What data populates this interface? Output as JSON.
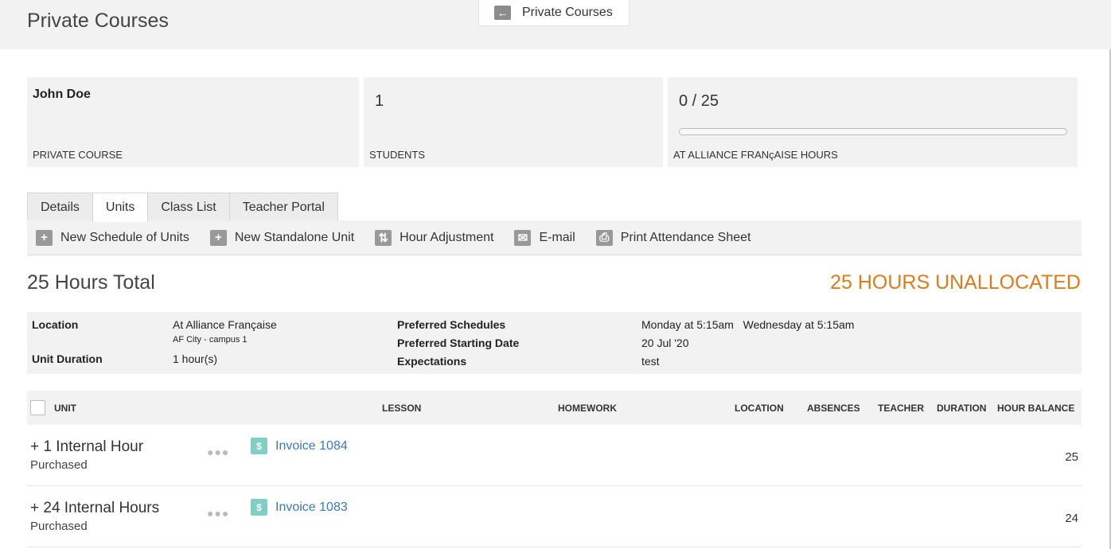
{
  "header": {
    "title": "Private Courses",
    "back_label": "Private Courses"
  },
  "cards": {
    "student_name": "John Doe",
    "course_type": "PRIVATE COURSE",
    "students_count": "1",
    "students_label": "STUDENTS",
    "hours_value": "0 / 25",
    "hours_progress_fraction": 0,
    "hours_label": "AT ALLIANCE FRANçAISE HOURS"
  },
  "tabs": [
    {
      "label": "Details",
      "active": false
    },
    {
      "label": "Units",
      "active": true
    },
    {
      "label": "Class List",
      "active": false
    },
    {
      "label": "Teacher Portal",
      "active": false
    }
  ],
  "toolbar": {
    "new_schedule": "New Schedule of Units",
    "new_standalone": "New Standalone Unit",
    "hour_adjustment": "Hour Adjustment",
    "email": "E-mail",
    "print_attendance": "Print Attendance Sheet"
  },
  "summary": {
    "total": "25 Hours Total",
    "unallocated": "25 HOURS UNALLOCATED",
    "unallocated_color": "#e07a1a"
  },
  "info": {
    "location_label": "Location",
    "location_value": "At Alliance Française",
    "location_sub": "AF City - campus 1",
    "unit_duration_label": "Unit Duration",
    "unit_duration_value": "1 hour(s)",
    "preferred_schedules_label": "Preferred Schedules",
    "preferred_schedules_value": "Monday at 5:15am   Wednesday at 5:15am",
    "preferred_start_label": "Preferred Starting Date",
    "preferred_start_value": "20 Jul '20",
    "expectations_label": "Expectations",
    "expectations_value": "test"
  },
  "table": {
    "columns": [
      "UNIT",
      "LESSON",
      "HOMEWORK",
      "LOCATION",
      "ABSENCES",
      "TEACHER",
      "DURATION",
      "HOUR BALANCE"
    ],
    "rows": [
      {
        "title": "+ 1 Internal Hour",
        "status": "Purchased",
        "invoice": "Invoice 1084",
        "balance": "25"
      },
      {
        "title": "+ 24 Internal Hours",
        "status": "Purchased",
        "invoice": "Invoice 1083",
        "balance": "24"
      }
    ]
  },
  "icons": {
    "back": "arrow-left-icon",
    "add": "plus-icon",
    "adjust": "swap-arrows-icon",
    "email": "envelope-icon",
    "print": "printer-icon",
    "invoice": "dollar-document-icon",
    "more": "more-dots-icon"
  },
  "colors": {
    "link": "#3b7ab5",
    "invoice_icon": "#7fcfc5",
    "panel_bg": "#f2f2f2"
  }
}
